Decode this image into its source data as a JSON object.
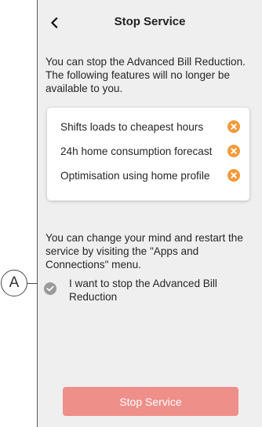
{
  "header": {
    "title": "Stop Service",
    "back_icon": "chevron-left-icon"
  },
  "intro_text": "You can stop the Advanced Bill Reduction. The following features will no longer be available to you.",
  "features": [
    {
      "label": "Shifts loads to cheapest hours",
      "icon": "cancel-circle-icon"
    },
    {
      "label": "24h home consumption forecast",
      "icon": "cancel-circle-icon"
    },
    {
      "label": "Optimisation using home profile",
      "icon": "cancel-circle-icon"
    }
  ],
  "outro_text": "You can change your mind and restart the service by visiting the \"Apps and Connections\" menu.",
  "consent": {
    "label": "I want to stop the Advanced Bill Reduction",
    "checked": false
  },
  "stop_button": {
    "label": "Stop Service"
  },
  "annotation": {
    "label": "A"
  },
  "colors": {
    "feature_icon": "#f29a3a",
    "button": "#ee8f8a",
    "background": "#efefef",
    "check_circle": "#9a9a9a"
  }
}
